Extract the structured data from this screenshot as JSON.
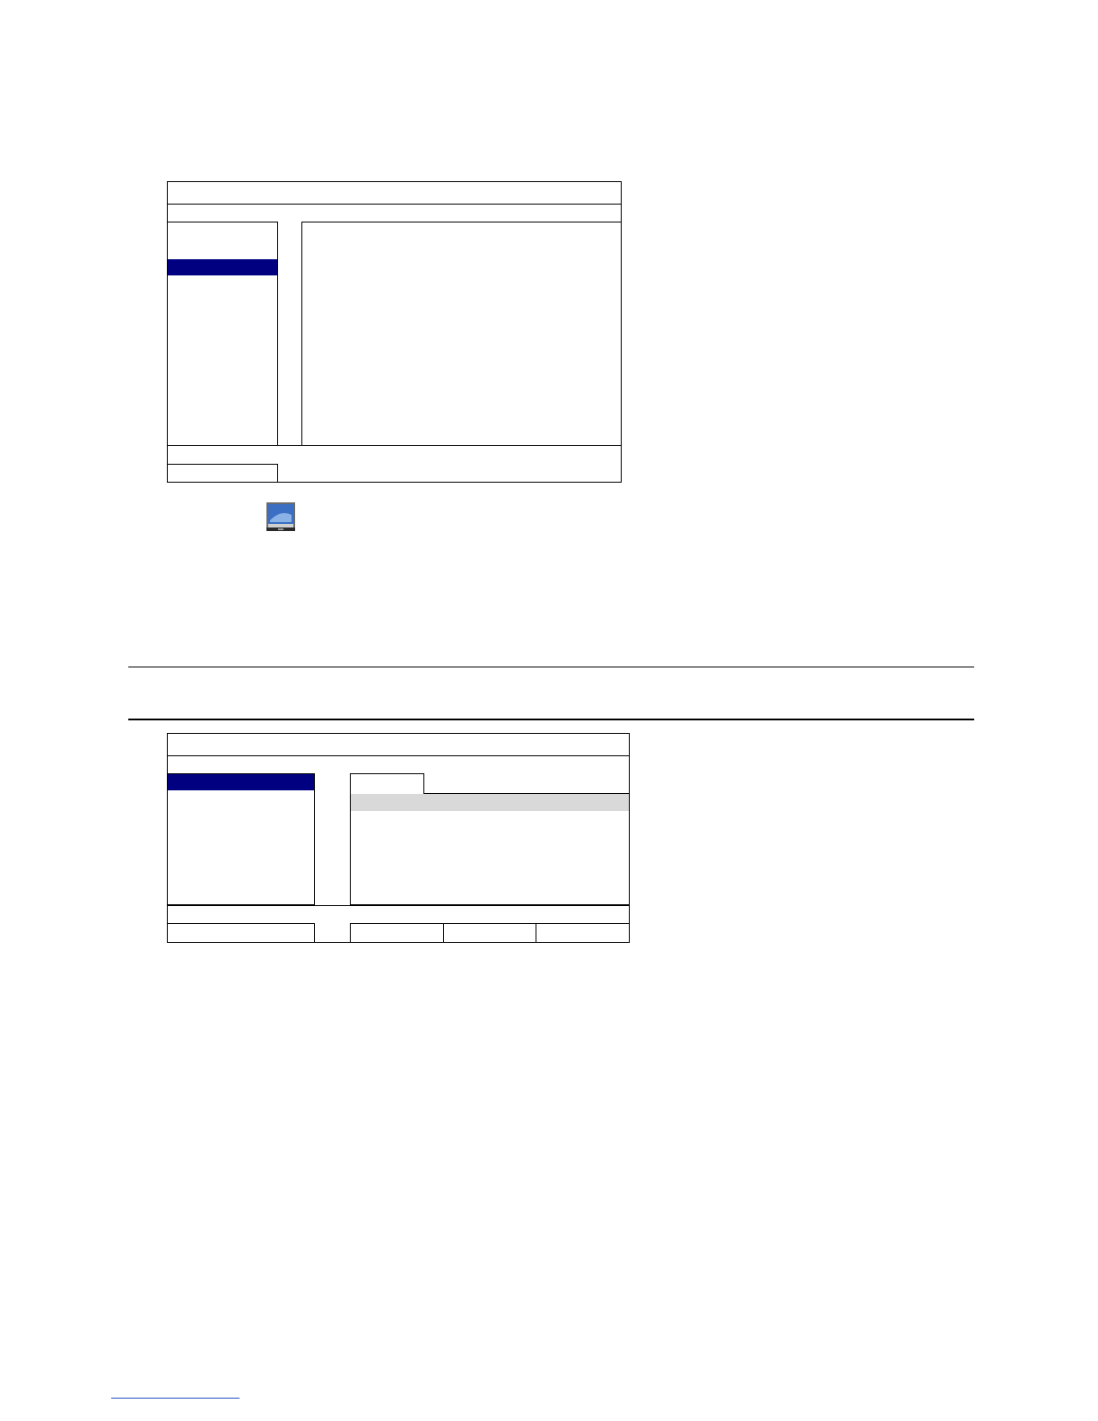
{
  "figure1": {
    "title_bar": "",
    "menu_items": [
      "",
      "",
      "",
      "",
      "",
      "",
      "",
      "",
      "",
      ""
    ],
    "selected_index": 2,
    "content": "",
    "footer": ""
  },
  "icon": {
    "name": "monitor-icon",
    "colors": {
      "screen": "#3a6fc4",
      "bezel": "#6b6b6b",
      "stand": "#2b2b2b"
    }
  },
  "section_divider": "",
  "figure2": {
    "title_bar": "",
    "menu_items": [
      "",
      "",
      "",
      "",
      "",
      "",
      ""
    ],
    "selected_index": 0,
    "tab_label": "",
    "list_rows": [
      "",
      "",
      "",
      "",
      "",
      ""
    ],
    "highlighted_row": 0,
    "buttons": [
      "",
      "",
      ""
    ],
    "footer": ""
  },
  "colors": {
    "selection": "#000080",
    "highlight": "#d9d9d9",
    "border": "#000000"
  }
}
